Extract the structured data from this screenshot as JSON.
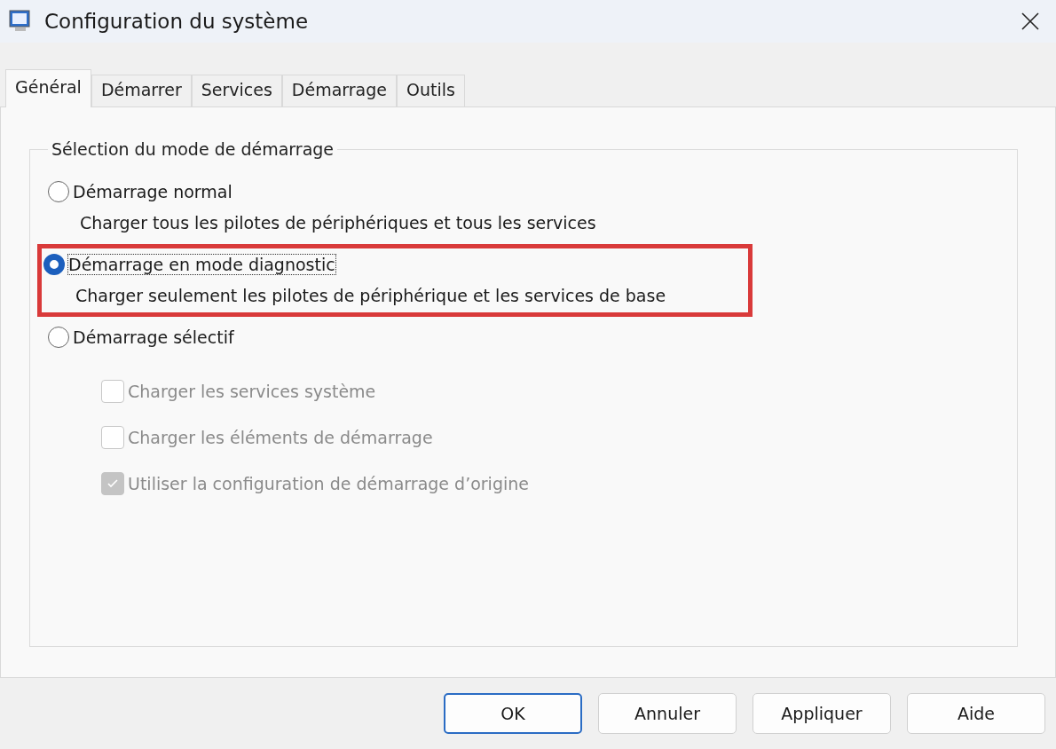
{
  "window": {
    "title": "Configuration du système"
  },
  "tabs": [
    {
      "label": "Général",
      "selected": true
    },
    {
      "label": "Démarrer",
      "selected": false
    },
    {
      "label": "Services",
      "selected": false
    },
    {
      "label": "Démarrage",
      "selected": false
    },
    {
      "label": "Outils",
      "selected": false
    }
  ],
  "group": {
    "title": "Sélection du mode de démarrage",
    "options": [
      {
        "label": "Démarrage normal",
        "description": "Charger tous les pilotes de périphériques et tous les services",
        "selected": false,
        "highlighted": false
      },
      {
        "label": "Démarrage en mode diagnostic",
        "description": "Charger seulement les pilotes de périphérique et les services de base",
        "selected": true,
        "highlighted": true
      },
      {
        "label": "Démarrage sélectif",
        "selected": false,
        "highlighted": false,
        "checkboxes": [
          {
            "label": "Charger les services système",
            "checked": false,
            "disabled": true
          },
          {
            "label": "Charger les éléments de démarrage",
            "checked": false,
            "disabled": true
          },
          {
            "label": "Utiliser la configuration de démarrage d’origine",
            "checked": true,
            "disabled": true
          }
        ]
      }
    ]
  },
  "buttons": [
    {
      "label": "OK",
      "default": true
    },
    {
      "label": "Annuler",
      "default": false
    },
    {
      "label": "Appliquer",
      "default": false
    },
    {
      "label": "Aide",
      "default": false
    }
  ]
}
